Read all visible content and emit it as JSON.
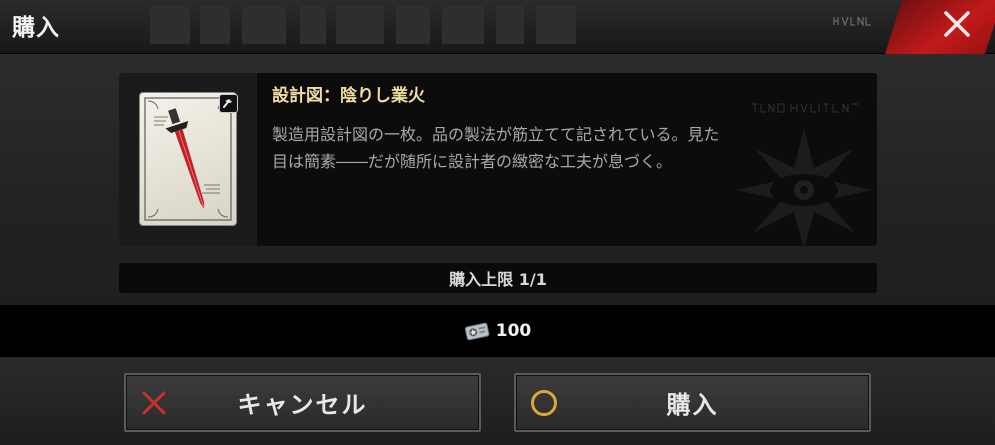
{
  "header": {
    "title": "購入",
    "close_icon": "close-icon"
  },
  "item": {
    "name": "設計図：陰りし業火",
    "description_line1": "製造用設計図の一枚。品の製法が筋立てて記されている。見た",
    "description_line2": "目は簡素――だが随所に設計者の緻密な工夫が息づく。",
    "type_icon": "hammer-icon",
    "image_icon": "blueprint-card-icon"
  },
  "limit": {
    "text": "購入上限 1/1"
  },
  "price": {
    "currency_icon": "ticket-icon",
    "value": "100"
  },
  "buttons": {
    "cancel_label": "キャンセル",
    "buy_label": "購入"
  },
  "colors": {
    "close_accent": "#c11a1a",
    "name_text": "#f1dca4",
    "cancel_x": "#c8322e",
    "buy_circle": "#d8a83a"
  }
}
